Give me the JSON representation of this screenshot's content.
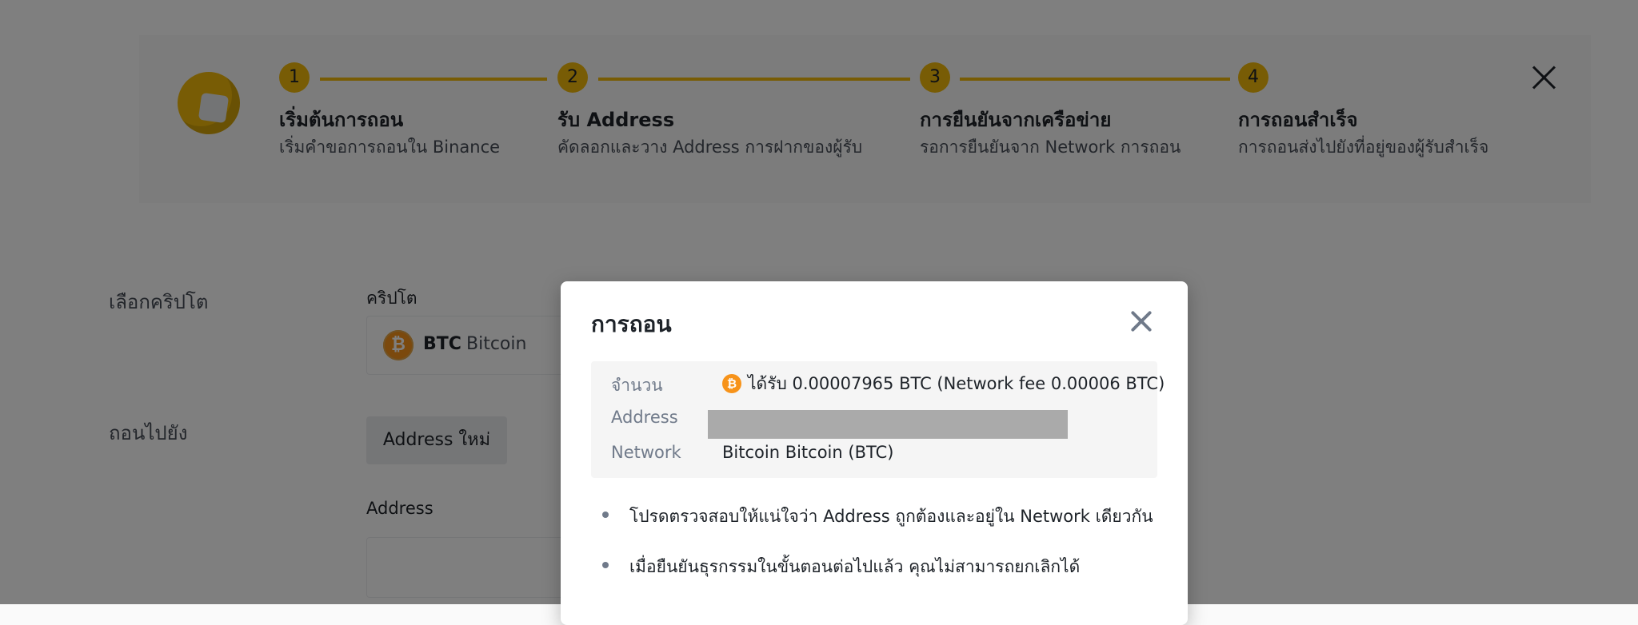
{
  "steps": [
    {
      "number": "1",
      "title": "เริ่มต้นการถอน",
      "subtitle": "เริ่มคำขอการถอนใน Binance"
    },
    {
      "number": "2",
      "title": "รับ Address",
      "subtitle": "คัดลอกและวาง Address การฝากของผู้รับ"
    },
    {
      "number": "3",
      "title": "การยืนยันจากเครือข่าย",
      "subtitle": "รอการยืนยันจาก Network การถอน"
    },
    {
      "number": "4",
      "title": "การถอนสำเร็จ",
      "subtitle": "การถอนส่งไปยังที่อยู่ของผู้รับสำเร็จ"
    }
  ],
  "form": {
    "select_crypto_label": "เลือกคริปโต",
    "crypto_field_label": "คริปโต",
    "coin": {
      "symbol": "BTC",
      "name": "Bitcoin",
      "icon": "bitcoin-icon",
      "icon_glyph": "₿"
    },
    "withdraw_to_label": "ถอนไปยัง",
    "new_address_tab": "Address ใหม่",
    "address_field_label": "Address"
  },
  "modal": {
    "title": "การถอน",
    "rows": {
      "amount_label": "จำนวน",
      "amount_value": "ได้รับ 0.00007965 BTC (Network fee 0.00006 BTC)",
      "address_label": "Address",
      "network_label": "Network",
      "network_value": "Bitcoin Bitcoin (BTC)"
    },
    "notes": [
      "โปรดตรวจสอบให้แน่ใจว่า Address ถูกต้องและอยู่ใน Network เดียวกัน",
      "เมื่อยืนยันธุรกรรมในขั้นตอนต่อไปแล้ว คุณไม่สามารถยกเลิกได้"
    ]
  },
  "colors": {
    "accent": "#f0b90b",
    "bitcoin": "#f7931a",
    "overlay": "rgba(0,0,0,0.5)"
  }
}
